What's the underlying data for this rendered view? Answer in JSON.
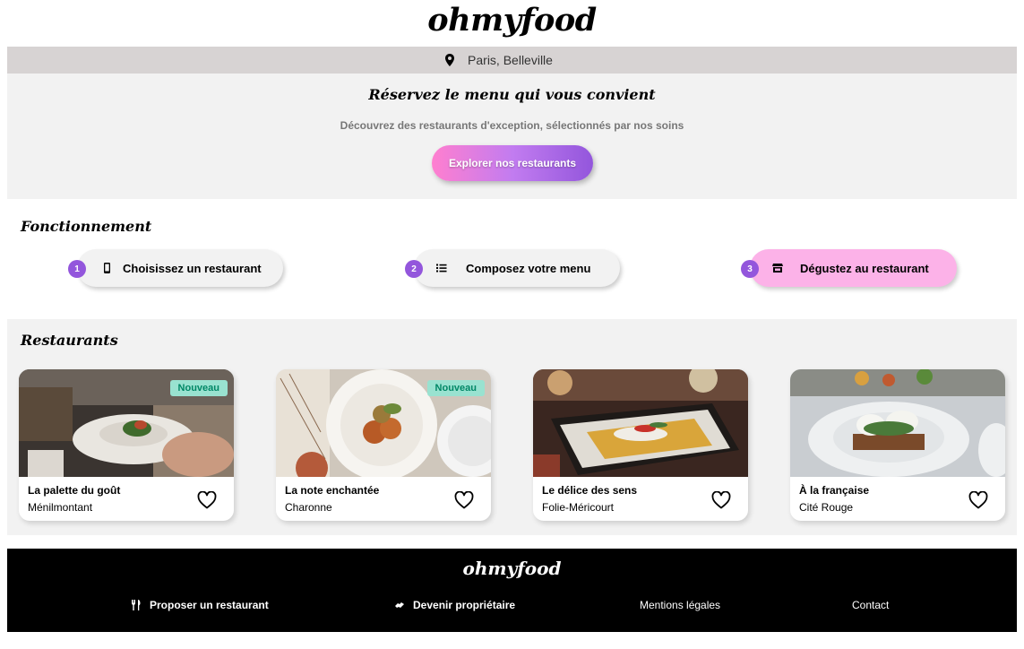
{
  "brand": {
    "logo": "ohmyfood"
  },
  "location": {
    "text": "Paris, Belleville",
    "icon": "map-pin-icon"
  },
  "hero": {
    "title": "Réservez le menu qui vous convient",
    "subtitle": "Découvrez des restaurants d'exception, sélectionnés par nos soins",
    "button_label": "Explorer nos restaurants"
  },
  "how_it_works": {
    "title": "Fonctionnement",
    "steps": [
      {
        "number": "1",
        "label": "Choisissez un restaurant",
        "icon": "smartphone-icon"
      },
      {
        "number": "2",
        "label": "Composez votre menu",
        "icon": "list-icon"
      },
      {
        "number": "3",
        "label": "Dégustez au restaurant",
        "icon": "store-icon"
      }
    ]
  },
  "restaurants": {
    "title": "Restaurants",
    "items": [
      {
        "name": "La palette du goût",
        "area": "Ménilmontant",
        "badge": "Nouveau"
      },
      {
        "name": "La note enchantée",
        "area": "Charonne",
        "badge": "Nouveau"
      },
      {
        "name": "Le délice des sens",
        "area": "Folie-Méricourt",
        "badge": ""
      },
      {
        "name": "À la française",
        "area": "Cité Rouge",
        "badge": ""
      }
    ]
  },
  "footer": {
    "logo": "ohmyfood",
    "links": [
      {
        "label": "Proposer un restaurant",
        "icon": "utensils-icon"
      },
      {
        "label": "Devenir propriétaire",
        "icon": "handshake-icon"
      },
      {
        "label": "Mentions légales"
      },
      {
        "label": "Contact"
      }
    ]
  },
  "colors": {
    "accent_purple": "#9356dc",
    "accent_pink": "#ff79da",
    "active_step": "#fcb2e8",
    "badge_bg": "#99e2d0",
    "badge_text": "#008766"
  }
}
